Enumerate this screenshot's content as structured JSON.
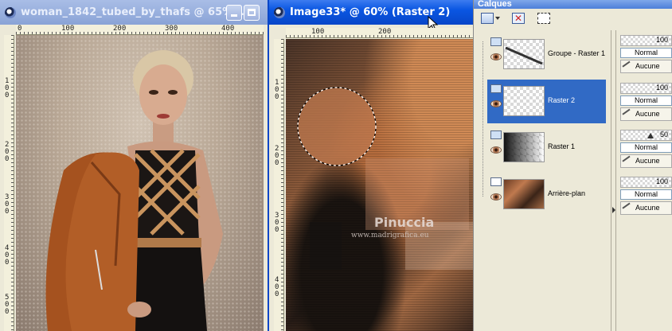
{
  "window_woman": {
    "title": "woman_1842_tubed_by_thafs  @  65%...",
    "ruler_top": [
      "0",
      "100",
      "200",
      "300",
      "400"
    ],
    "ruler_left": [
      "1",
      "0",
      "0",
      "2",
      "0",
      "0",
      "3",
      "0",
      "0",
      "4",
      "0",
      "0",
      "5",
      "0",
      "0"
    ]
  },
  "window_image": {
    "title": "Image33*  @   60% (Raster 2)",
    "ruler_top": [
      "100",
      "200"
    ],
    "ruler_left": [
      "1",
      "0",
      "0",
      "2",
      "0",
      "0",
      "3",
      "0",
      "0",
      "4",
      "0",
      "0"
    ],
    "watermark_name": "Pinuccia",
    "watermark_url": "www.madrigrafica.eu"
  },
  "layers_panel": {
    "title": "Calques",
    "layers": [
      {
        "name": "Groupe - Raster 1",
        "opacity": "100",
        "blend": "Normal",
        "link": "Aucune",
        "selected": false
      },
      {
        "name": "Raster 2",
        "opacity": "100",
        "blend": "Normal",
        "link": "Aucune",
        "selected": true
      },
      {
        "name": "Raster 1",
        "opacity": "50",
        "blend": "Normal",
        "link": "Aucune",
        "selected": false
      },
      {
        "name": "Arrière-plan",
        "opacity": "100",
        "blend": "Normal",
        "link": "Aucune",
        "selected": false
      }
    ]
  },
  "colors": {
    "titlebar_active": "#0a56e2",
    "selection_blue": "#316ac5",
    "panel_bg": "#ece9d8"
  },
  "icons": [
    "app-icon",
    "minimize-icon",
    "maximize-icon",
    "close-icon",
    "new-layer-icon",
    "delete-layer-icon",
    "mask-icon",
    "eye-icon",
    "link-icon",
    "cursor-icon"
  ]
}
